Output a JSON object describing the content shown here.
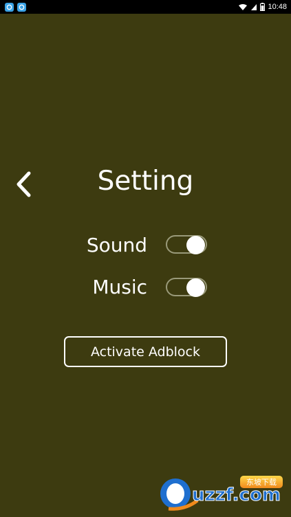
{
  "status_bar": {
    "time": "10:48"
  },
  "header": {
    "title": "Setting"
  },
  "settings": {
    "sound": {
      "label": "Sound",
      "enabled": true
    },
    "music": {
      "label": "Music",
      "enabled": true
    }
  },
  "actions": {
    "adblock_label": "Activate Adblock"
  },
  "watermark": {
    "text": "uzzf.com",
    "subtext": "东坡下载"
  },
  "colors": {
    "background": "#3d3b10",
    "text": "#ffffff",
    "toggle_knob": "#ffffff"
  }
}
